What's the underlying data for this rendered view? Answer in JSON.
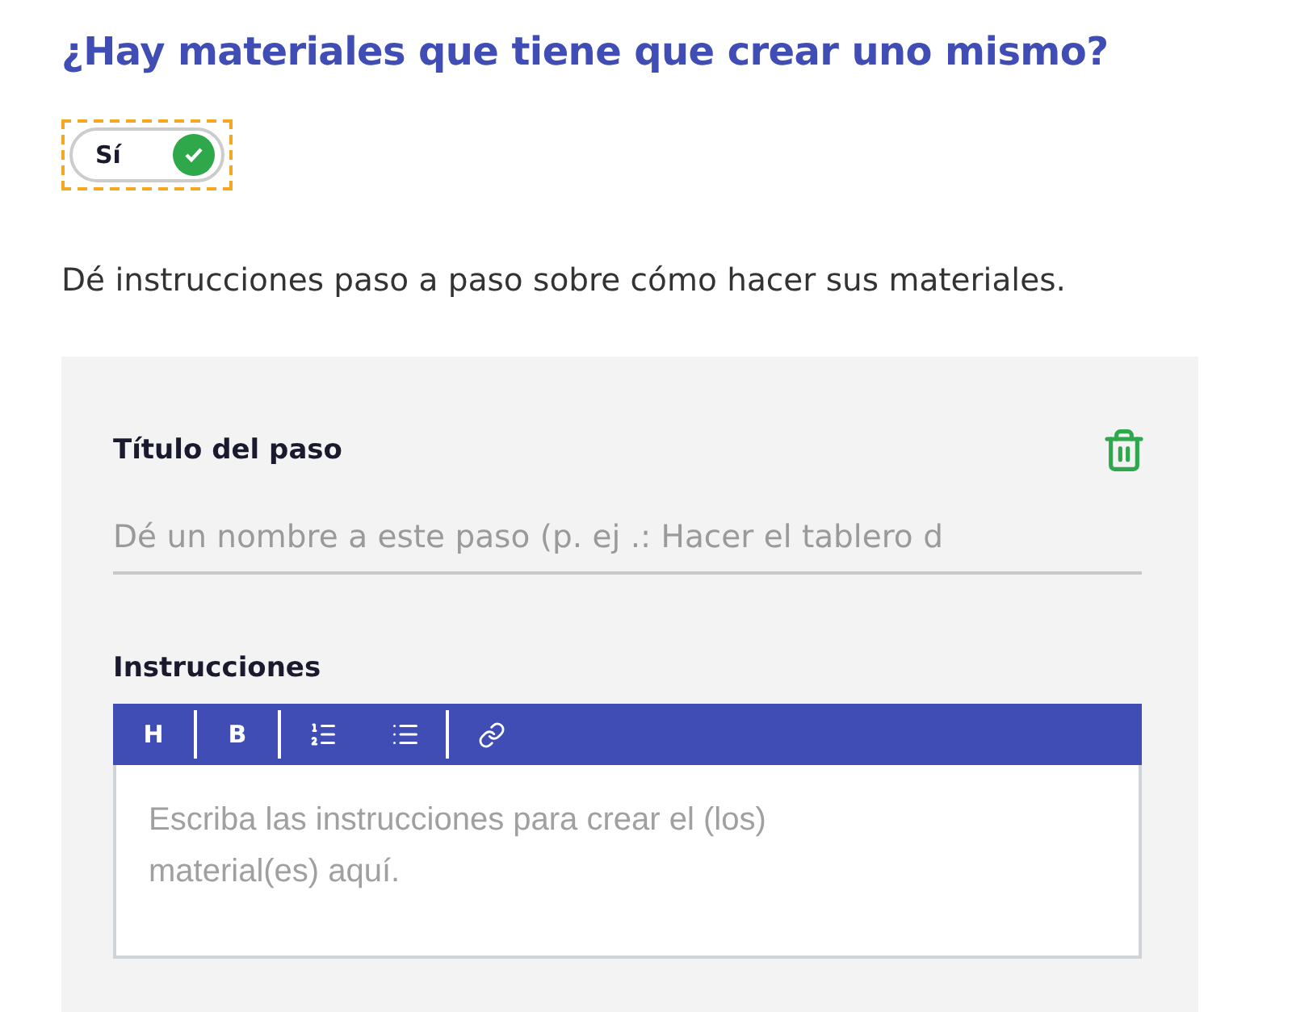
{
  "question": {
    "title": "¿Hay materiales que tiene que crear uno mismo?"
  },
  "toggle": {
    "label": "Sí",
    "on": true,
    "focused": true
  },
  "description": "Dé instrucciones paso a paso sobre cómo hacer sus materiales.",
  "step": {
    "title_label": "Título del paso",
    "title_placeholder": "Dé un nombre a este paso (p. ej .: Hacer el tablero d",
    "instructions_label": "Instrucciones",
    "toolbar": [
      {
        "kind": "text",
        "label": "H"
      },
      {
        "kind": "text",
        "label": "B"
      },
      {
        "kind": "ordered-list"
      },
      {
        "kind": "bullet-list"
      },
      {
        "kind": "link"
      }
    ],
    "instructions_placeholder": "Escriba las instrucciones para crear el (los) material(es) aquí."
  }
}
